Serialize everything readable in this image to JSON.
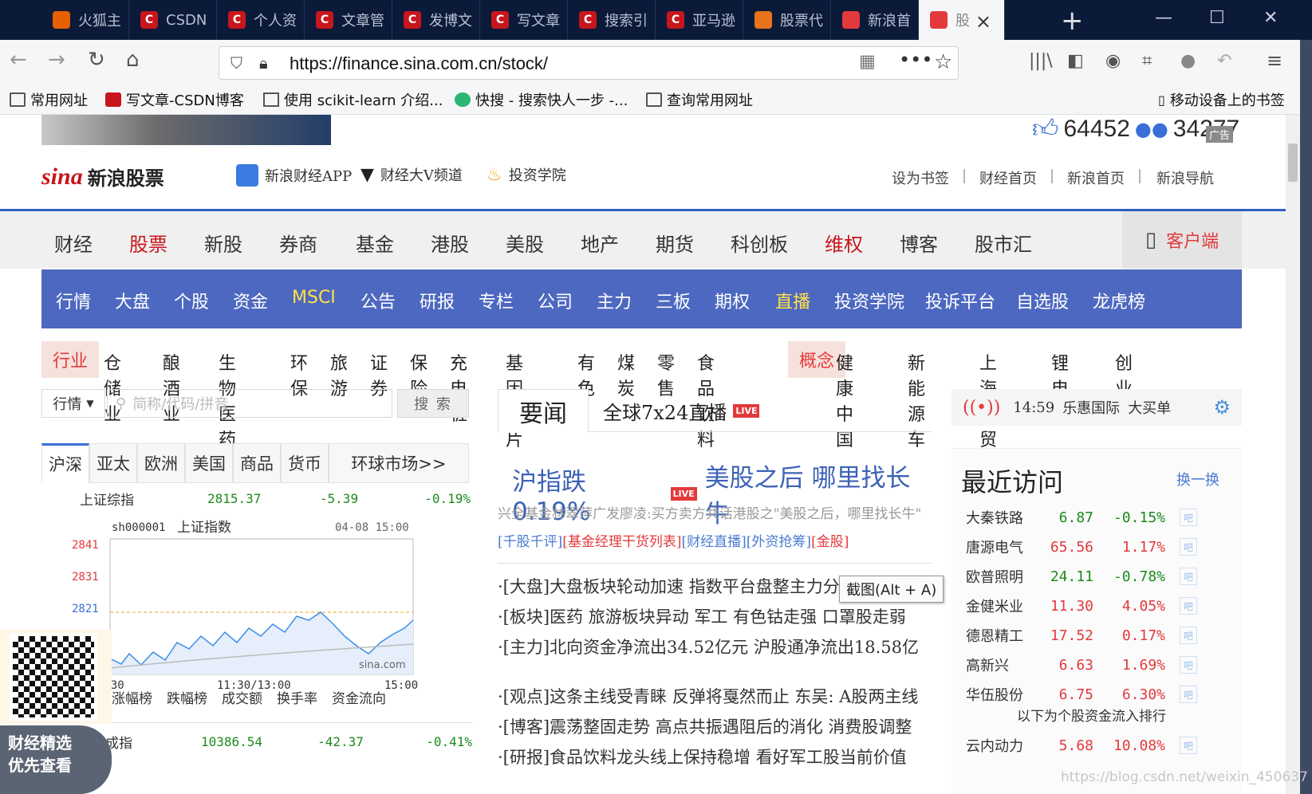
{
  "browser": {
    "tabs": [
      {
        "title": "火狐主",
        "icon": "firefox-icon",
        "color": "#e66000"
      },
      {
        "title": "CSDN",
        "icon": "csdn-icon",
        "color": "#c8161d"
      },
      {
        "title": "个人资",
        "icon": "csdn-icon",
        "color": "#c8161d"
      },
      {
        "title": "文章管",
        "icon": "csdn-icon",
        "color": "#c8161d"
      },
      {
        "title": "发博文",
        "icon": "csdn-icon",
        "color": "#c8161d"
      },
      {
        "title": "写文章",
        "icon": "csdn-icon",
        "color": "#c8161d"
      },
      {
        "title": "搜索引",
        "icon": "csdn-icon",
        "color": "#c8161d"
      },
      {
        "title": "亚马逊",
        "icon": "csdn-icon",
        "color": "#c8161d"
      },
      {
        "title": "股票代",
        "icon": "wing-icon",
        "color": "#e8731a"
      },
      {
        "title": "新浪首",
        "icon": "weibo-icon",
        "color": "#e4393c"
      },
      {
        "title": "股",
        "icon": "weibo-icon",
        "color": "#e4393c"
      }
    ],
    "url": "https://finance.sina.com.cn/stock/",
    "bookmarks": [
      "常用网址",
      "写文章-CSDN博客",
      "使用 scikit-learn 介绍...",
      "快搜 - 搜索快人一步 -...",
      "查询常用网址"
    ],
    "mobile_bookmarks": "移动设备上的书签"
  },
  "page": {
    "likes": "64452",
    "comments": "34277",
    "ad_label": "广告",
    "logo_text": "新浪股票",
    "logo_sina": "sina",
    "header_links": [
      "新浪财经APP",
      "财经大V频道",
      "投资学院"
    ],
    "top_links": [
      "设为书签",
      "财经首页",
      "新浪首页",
      "新浪导航"
    ],
    "main_nav": [
      "财经",
      "股票",
      "新股",
      "券商",
      "基金",
      "港股",
      "美股",
      "地产",
      "期货",
      "科创板",
      "维权",
      "博客",
      "股市汇"
    ],
    "client_btn": "客户端",
    "sub_nav": [
      "行情",
      "大盘",
      "个股",
      "资金",
      "MSCI",
      "公告",
      "研报",
      "专栏",
      "公司",
      "主力",
      "三板",
      "期权",
      "直播",
      "投资学院",
      "投诉平台",
      "自选股",
      "龙虎榜"
    ],
    "industry_label": "行业",
    "industries": [
      "仓储业",
      "酿酒业",
      "生物医药",
      "环保",
      "旅游",
      "证券",
      "保险",
      "充电桩",
      "基因芯片",
      "有色",
      "煤炭",
      "零售",
      "食品饮料"
    ],
    "concept_label": "概念",
    "concepts": [
      "健康中国",
      "新能源车",
      "上海自贸",
      "锂电池",
      "创业板"
    ],
    "search": {
      "select": "行情",
      "placeholder": "简称/代码/拼音",
      "button": "搜 索"
    },
    "market_tabs": [
      "沪深",
      "亚太",
      "欧洲",
      "美国",
      "商品",
      "货币",
      "环球市场>>"
    ],
    "index_row": {
      "name": "上证综指",
      "value": "2815.37",
      "change": "-5.39",
      "pct": "-0.19%"
    },
    "mini_chart": {
      "code": "sh000001",
      "name": "上证指数",
      "time": "04-08 15:00",
      "yticks": [
        "2841",
        "2831",
        "2821"
      ],
      "xticks": [
        "9:30",
        "11:30/13:00",
        "15:00"
      ],
      "source": "sina.com"
    },
    "rank_links": [
      "涨幅榜",
      "跌幅榜",
      "成交额",
      "换手率",
      "资金流向"
    ],
    "bottom_row": {
      "name": "成指",
      "value": "10386.54",
      "change": "-42.37",
      "pct": "-0.41%"
    },
    "news": {
      "tab1": "要闻",
      "tab2": "全球7x24直播",
      "live": "LIVE",
      "headline1": "沪指跌0.19%",
      "headline2": "美股之后 哪里找长牛",
      "summary": "兴全基金林翠萍广发廖凌:买方卖方共话港股之\"美股之后，哪里找长牛\"",
      "summary_links": [
        "[千股千评]",
        "[基金经理干货列表]",
        "[财经直播]",
        "[外资抢筹]",
        "[金股]"
      ],
      "items": [
        "·[大盘]大盘板块轮动加速 指数平台盘整主力分歧加剧",
        "·[板块]医药 旅游板块异动 军工 有色钴走强 口罩股走弱",
        "·[主力]北向资金净流出34.52亿元 沪股通净流出18.58亿",
        "·[观点]这条主线受青睐 反弹将戛然而止 东吴: A股两主线",
        "·[博客]震荡整固走势 高点共振遇阻后的消化 消费股调整",
        "·[研报]食品饮料龙头线上保持稳增 看好军工股当前价值"
      ]
    },
    "ticker": {
      "time": "14:59",
      "name": "乐惠国际",
      "action": "大买单"
    },
    "recent": {
      "title": "最近访问",
      "switch": "换一换",
      "rows": [
        {
          "name": "大秦铁路",
          "price": "6.87",
          "chg": "-0.15%",
          "dir": "down"
        },
        {
          "name": "唐源电气",
          "price": "65.56",
          "chg": "1.17%",
          "dir": "up"
        },
        {
          "name": "欧普照明",
          "price": "24.11",
          "chg": "-0.78%",
          "dir": "down"
        },
        {
          "name": "金健米业",
          "price": "11.30",
          "chg": "4.05%",
          "dir": "up"
        },
        {
          "name": "德恩精工",
          "price": "17.52",
          "chg": "0.17%",
          "dir": "up"
        },
        {
          "name": "高新兴",
          "price": "6.63",
          "chg": "1.69%",
          "dir": "up"
        },
        {
          "name": "华伍股份",
          "price": "6.75",
          "chg": "6.30%",
          "dir": "up"
        }
      ],
      "bar_label": "吧",
      "flow_title": "以下为个股资金流入排行",
      "flow_row": {
        "name": "云内动力",
        "price": "5.68",
        "chg": "10.08%",
        "dir": "up"
      }
    },
    "tooltip": "截图(Alt + A)",
    "qr_caption1": "财经精选",
    "qr_caption2": "优先查看",
    "watermark": "https://blog.csdn.net/weixin_450637"
  }
}
